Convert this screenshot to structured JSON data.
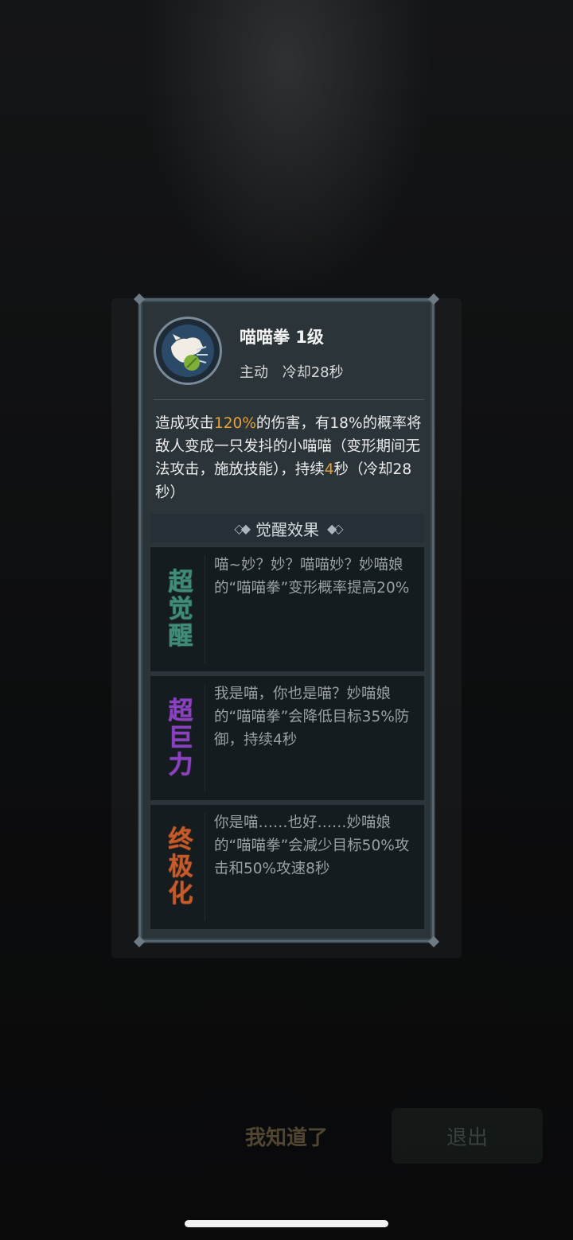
{
  "skill": {
    "name": "喵喵拳 1级",
    "type": "主动",
    "cooldown": "冷却28秒",
    "icon": "cat-punch-icon"
  },
  "description": {
    "p1": "造成攻击",
    "hl1": "120%",
    "p2": "的伤害，有18%的概率将敌人变成一只发抖的小喵喵（变形期间无法攻击，施放技能），持续",
    "hl2": "4",
    "p3": "秒（冷却28秒）"
  },
  "awaken": {
    "title": "觉醒效果",
    "items": [
      {
        "badge": [
          "超",
          "觉",
          "醒"
        ],
        "text": "喵~妙？妙？喵喵妙？妙喵娘的“喵喵拳”变形概率提高20%",
        "color": "#3f8c78"
      },
      {
        "badge": [
          "超",
          "巨",
          "力"
        ],
        "text": "我是喵，你也是喵？妙喵娘的“喵喵拳”会降低目标35%防御，持续4秒",
        "color": "#8a42c0"
      },
      {
        "badge": [
          "终",
          "极",
          "化"
        ],
        "text": "你是喵……也好……妙喵娘的“喵喵拳”会减少目标50%攻击和50%攻速8秒",
        "color": "#c65a2a"
      }
    ]
  },
  "buttons": {
    "acknowledge": "我知道了",
    "exit": "退出"
  },
  "colors": {
    "highlight": "#e6a23a",
    "panel": "#2b3438"
  }
}
